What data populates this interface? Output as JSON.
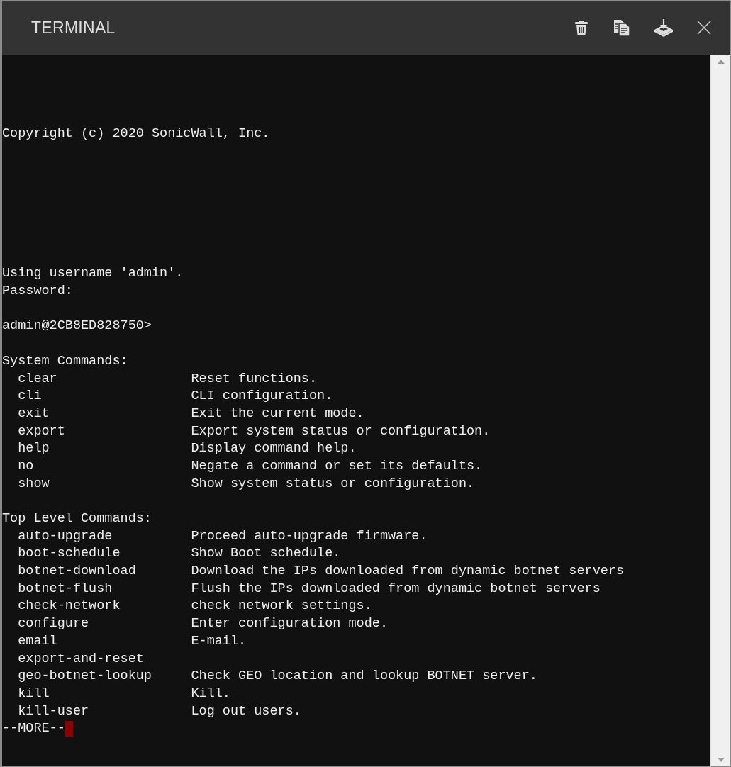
{
  "window": {
    "title": "TERMINAL"
  },
  "toolbar": [
    {
      "kind": "trash"
    },
    {
      "kind": "copy"
    },
    {
      "kind": "download"
    },
    {
      "kind": "close"
    }
  ],
  "terminal": {
    "banner": "Copyright (c) 2020 SonicWall, Inc.",
    "login": [
      "Using username 'admin'.",
      "Password:"
    ],
    "prompt": "admin@2CB8ED828750>",
    "sections": [
      {
        "heading": "System Commands:",
        "commands": [
          {
            "name": "clear",
            "description": "Reset functions."
          },
          {
            "name": "cli",
            "description": "CLI configuration."
          },
          {
            "name": "exit",
            "description": "Exit the current mode."
          },
          {
            "name": "export",
            "description": "Export system status or configuration."
          },
          {
            "name": "help",
            "description": "Display command help."
          },
          {
            "name": "no",
            "description": "Negate a command or set its defaults."
          },
          {
            "name": "show",
            "description": "Show system status or configuration."
          }
        ]
      },
      {
        "heading": "Top Level Commands:",
        "commands": [
          {
            "name": "auto-upgrade",
            "description": "Proceed auto-upgrade firmware."
          },
          {
            "name": "boot-schedule",
            "description": "Show Boot schedule."
          },
          {
            "name": "botnet-download",
            "description": "Download the IPs downloaded from dynamic botnet servers"
          },
          {
            "name": "botnet-flush",
            "description": "Flush the IPs downloaded from dynamic botnet servers"
          },
          {
            "name": "check-network",
            "description": "check network settings."
          },
          {
            "name": "configure",
            "description": "Enter configuration mode."
          },
          {
            "name": "email",
            "description": "E-mail."
          },
          {
            "name": "export-and-reset"
          },
          {
            "name": "geo-botnet-lookup",
            "description": "Check GEO location and lookup BOTNET server."
          },
          {
            "name": "kill",
            "description": "Kill."
          },
          {
            "name": "kill-user",
            "description": "Log out users."
          }
        ]
      }
    ],
    "pager": "--MORE--",
    "cursor": true
  }
}
